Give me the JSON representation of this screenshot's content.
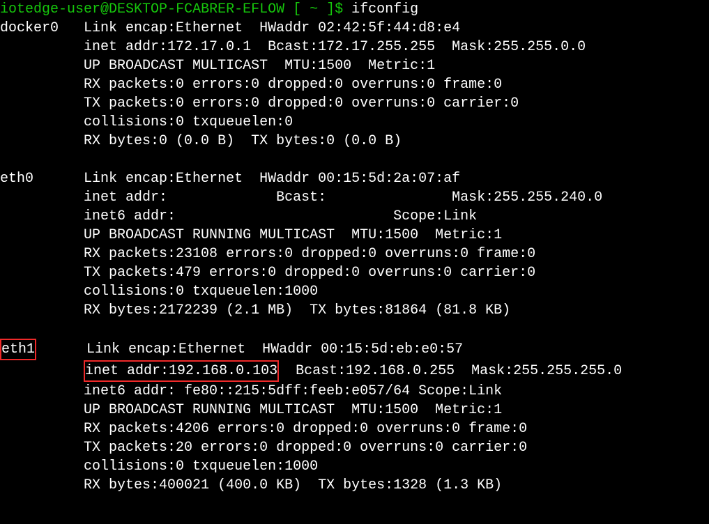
{
  "prompt": {
    "user": "iotedge-user",
    "host": "DESKTOP-FCABRER-EFLOW",
    "path": "~",
    "command": "ifconfig"
  },
  "interfaces": {
    "docker0": {
      "name": "docker0",
      "link": "Link encap:Ethernet  HWaddr 02:42:5f:44:d8:e4",
      "inet": "inet addr:172.17.0.1  Bcast:172.17.255.255  Mask:255.255.0.0",
      "status": "UP BROADCAST MULTICAST  MTU:1500  Metric:1",
      "rx_pkts": "RX packets:0 errors:0 dropped:0 overruns:0 frame:0",
      "tx_pkts": "TX packets:0 errors:0 dropped:0 overruns:0 carrier:0",
      "coll": "collisions:0 txqueuelen:0",
      "bytes": "RX bytes:0 (0.0 B)  TX bytes:0 (0.0 B)"
    },
    "eth0": {
      "name": "eth0",
      "link": "Link encap:Ethernet  HWaddr 00:15:5d:2a:07:af",
      "inet": "inet addr:             Bcast:               Mask:255.255.240.0",
      "inet6": "inet6 addr:                          Scope:Link",
      "status": "UP BROADCAST RUNNING MULTICAST  MTU:1500  Metric:1",
      "rx_pkts": "RX packets:23108 errors:0 dropped:0 overruns:0 frame:0",
      "tx_pkts": "TX packets:479 errors:0 dropped:0 overruns:0 carrier:0",
      "coll": "collisions:0 txqueuelen:1000",
      "bytes": "RX bytes:2172239 (2.1 MB)  TX bytes:81864 (81.8 KB)"
    },
    "eth1": {
      "name": "eth1",
      "link": "Link encap:Ethernet  HWaddr 00:15:5d:eb:e0:57",
      "inet_addr_hl": "inet addr:192.168.0.103",
      "inet_rest": "  Bcast:192.168.0.255  Mask:255.255.255.0",
      "inet6": "inet6 addr: fe80::215:5dff:feeb:e057/64 Scope:Link",
      "status": "UP BROADCAST RUNNING MULTICAST  MTU:1500  Metric:1",
      "rx_pkts": "RX packets:4206 errors:0 dropped:0 overruns:0 frame:0",
      "tx_pkts": "TX packets:20 errors:0 dropped:0 overruns:0 carrier:0",
      "coll": "collisions:0 txqueuelen:1000",
      "bytes": "RX bytes:400021 (400.0 KB)  TX bytes:1328 (1.3 KB)"
    }
  },
  "indent": "          "
}
